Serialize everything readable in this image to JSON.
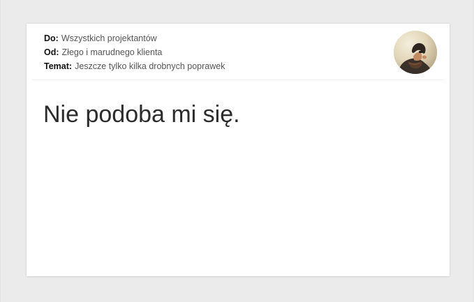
{
  "email": {
    "to_label": "Do:",
    "to_value": "Wszystkich projektantów",
    "from_label": "Od:",
    "from_value": "Złego i marudnego klienta",
    "subject_label": "Temat:",
    "subject_value": "Jeszcze tylko kilka drobnych poprawek",
    "body_text": "Nie podoba mi się."
  },
  "avatar": {
    "icon": "person-photo-avatar"
  },
  "colors": {
    "background": "#ebebeb",
    "card": "#ffffff",
    "label": "#111111",
    "value": "#555555",
    "body_text": "#2b2b2b"
  }
}
